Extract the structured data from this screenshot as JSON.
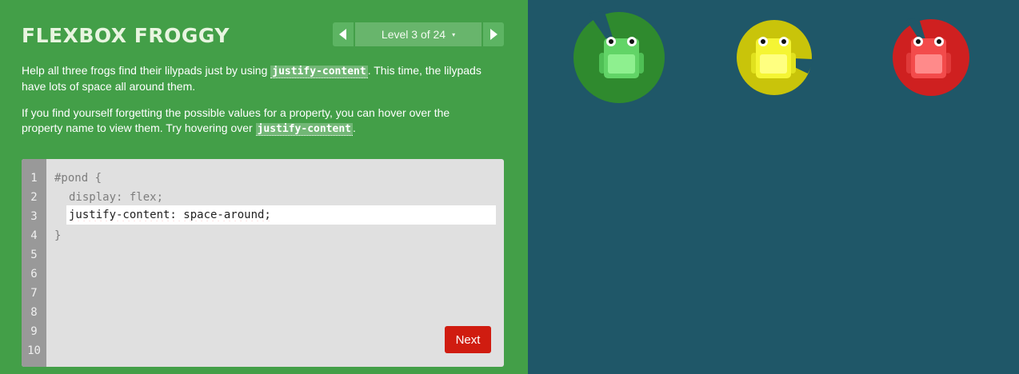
{
  "title": "FLEXBOX FROGGY",
  "level": {
    "label": "Level 3 of 24",
    "caret": "▾",
    "prev_icon": "triangle-left-icon",
    "next_icon": "triangle-right-icon"
  },
  "instructions": {
    "p1_before": "Help all three frogs find their lilypads just by using ",
    "p1_code": "justify-content",
    "p1_after": ". This time, the lilypads have lots of space all around them.",
    "p2_before": "If you find yourself forgetting the possible values for a property, you can hover over the property name to view them. Try hovering over ",
    "p2_code": "justify-content",
    "p2_after": "."
  },
  "editor": {
    "line_numbers": [
      "1",
      "2",
      "3",
      "4",
      "5",
      "6",
      "7",
      "8",
      "9",
      "10"
    ],
    "line1": "#pond {",
    "line2": "display: flex;",
    "answer": "justify-content: space-around;",
    "line4": "}"
  },
  "next_label": "Next",
  "pond": {
    "lilypads": [
      {
        "color": "green",
        "fill": "#2f8a2e",
        "dark": "#25772a"
      },
      {
        "color": "yellow",
        "fill": "#c9c40a",
        "dark": "#b3ae09"
      },
      {
        "color": "red",
        "fill": "#cf2020",
        "dark": "#b81a1a"
      }
    ],
    "frogs": [
      {
        "color": "green",
        "body": "#62d467",
        "belly": "#8ef08f"
      },
      {
        "color": "yellow",
        "body": "#f5f534",
        "belly": "#ffff80"
      },
      {
        "color": "red",
        "body": "#f34b4b",
        "belly": "#ff8a8a"
      }
    ]
  },
  "colors": {
    "sidebar_bg": "#439f48",
    "pond_bg": "#1f5768",
    "next_button": "#d01c10"
  }
}
